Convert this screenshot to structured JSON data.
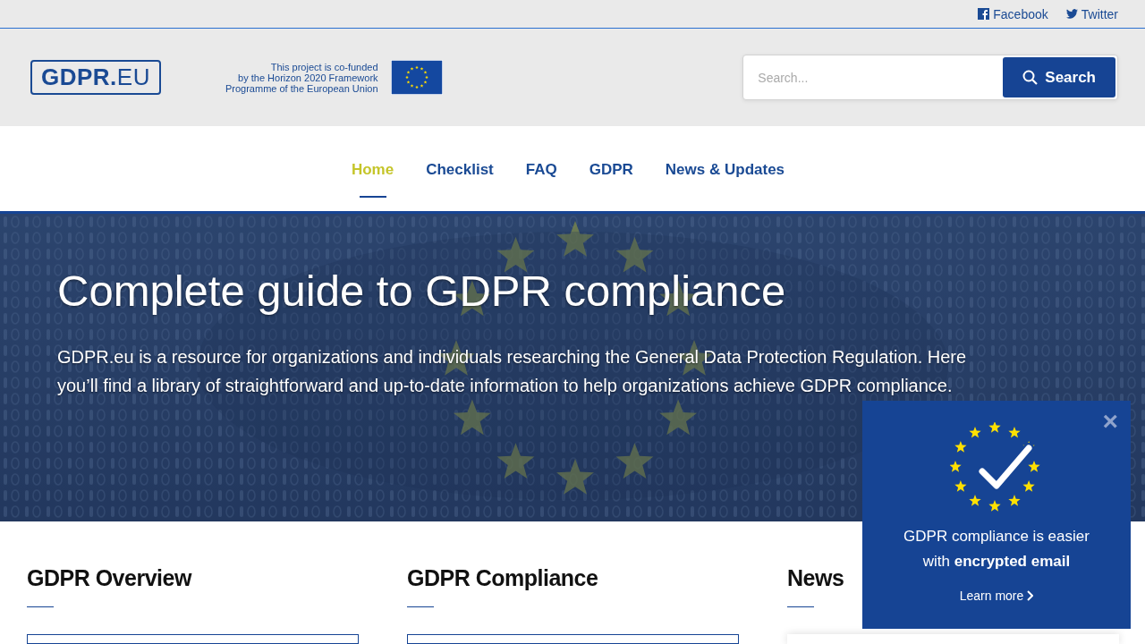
{
  "top_links": [
    {
      "kind": "facebook",
      "label": "Facebook"
    },
    {
      "kind": "twitter",
      "label": "Twitter"
    }
  ],
  "logo": "**GDPR.**EU",
  "cofunding": "This project is co-funded\nby the Horizon 2020 Framework\nProgramme of the European Union",
  "search": {
    "placeholder": "Search...",
    "button": "Search"
  },
  "nav": [
    {
      "label": "Home",
      "selected": true
    },
    {
      "label": "Checklist",
      "selected": false
    },
    {
      "label": "FAQ",
      "selected": false
    },
    {
      "label": "GDPR",
      "selected": false
    },
    {
      "label": "News & Updates",
      "selected": false
    }
  ],
  "hero": {
    "title": "Complete guide to GDPR compliance",
    "text": "GDPR.eu is a resource for organizations and individuals researching the General Data Protection Regulation. Here you’ll find a library of straightforward and up-to-date information to help organizations achieve GDPR compliance."
  },
  "sections": [
    {
      "title": "GDPR Overview"
    },
    {
      "title": "GDPR Compliance"
    },
    {
      "title": "News"
    }
  ],
  "popup": {
    "close": "×",
    "text": "GDPR compliance is easier with **encrypted email**",
    "link": "Learn more"
  }
}
